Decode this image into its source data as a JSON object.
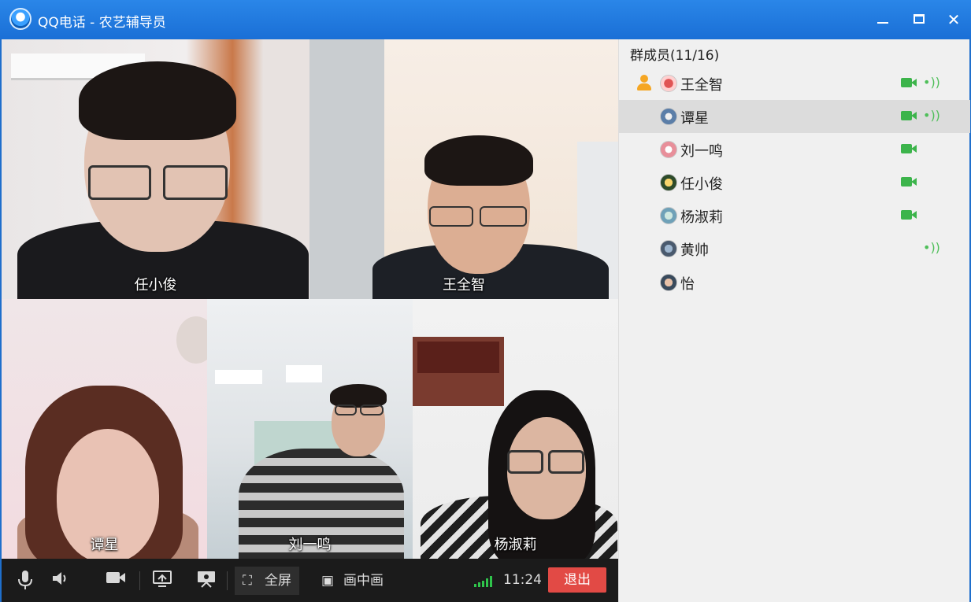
{
  "window": {
    "title": "QQ电话 - 农艺辅导员",
    "min_label": "minimize",
    "max_label": "maximize",
    "close_label": "close"
  },
  "video_tiles": [
    {
      "name": "任小俊"
    },
    {
      "name": "王全智"
    },
    {
      "name": "谭星"
    },
    {
      "name": "刘一鸣"
    },
    {
      "name": "杨淑莉"
    }
  ],
  "toolbar": {
    "fullscreen_label": "全屏",
    "pip_label": "画中画",
    "timer": "11:24",
    "exit_label": "退出",
    "icons": [
      "microphone-icon",
      "speaker-icon",
      "camera-icon",
      "screen-share-icon",
      "presentation-icon",
      "fullscreen-icon",
      "picture-in-picture-icon",
      "signal-icon"
    ]
  },
  "panel": {
    "title": "群成员(11/16)",
    "members": [
      {
        "name": "王全智",
        "owner": true,
        "video": true,
        "audio": true,
        "selected": false
      },
      {
        "name": "谭星",
        "owner": false,
        "video": true,
        "audio": true,
        "selected": true
      },
      {
        "name": "刘一鸣",
        "owner": false,
        "video": true,
        "audio": false,
        "selected": false
      },
      {
        "name": "任小俊",
        "owner": false,
        "video": true,
        "audio": false,
        "selected": false
      },
      {
        "name": "杨淑莉",
        "owner": false,
        "video": true,
        "audio": false,
        "selected": false
      },
      {
        "name": "黄帅",
        "owner": false,
        "video": false,
        "audio": true,
        "selected": false
      },
      {
        "name": "怡",
        "owner": false,
        "video": false,
        "audio": false,
        "selected": false
      }
    ]
  },
  "colors": {
    "titlebar": "#1f6fcc",
    "exit": "#e24a45",
    "video_status": "#3cb44b"
  }
}
